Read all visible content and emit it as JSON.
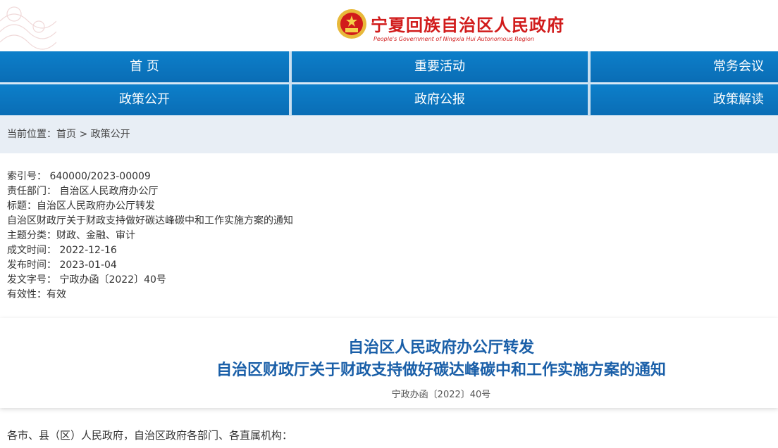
{
  "header": {
    "site_title": "宁夏回族自治区人民政府",
    "site_subtitle": "People's Government of Ningxia Hui Autonomous Region",
    "emblem_icon": "national-emblem-icon"
  },
  "nav": {
    "row1": [
      "首 页",
      "重要活动",
      "常务会议"
    ],
    "row2": [
      "政策公开",
      "政府公报",
      "政策解读"
    ]
  },
  "breadcrumb": {
    "prefix": "当前位置：",
    "home": "首页",
    "separator": " > ",
    "current": "政策公开"
  },
  "meta": [
    "索引号： 640000/2023-00009",
    "责任部门： 自治区人民政府办公厅",
    "标题：自治区人民政府办公厅转发",
    "自治区财政厅关于财政支持做好碳达峰碳中和工作实施方案的通知",
    "主题分类：财政、金融、审计",
    "成文时间： 2022-12-16",
    "发布时间： 2023-01-04",
    "发文字号： 宁政办函〔2022〕40号",
    "有效性：有效"
  ],
  "document": {
    "title_line1": "自治区人民政府办公厅转发",
    "title_line2": "自治区财政厅关于财政支持做好碳达峰碳中和工作实施方案的通知",
    "doc_number": "宁政办函〔2022〕40号",
    "salutation": "各市、县（区）人民政府，自治区政府各部门、各直属机构："
  },
  "colors": {
    "nav_blue": "#0d7fca",
    "title_blue": "#1a5fa8",
    "brand_red": "#d11b1b",
    "crumb_bg": "#e8eef5"
  }
}
